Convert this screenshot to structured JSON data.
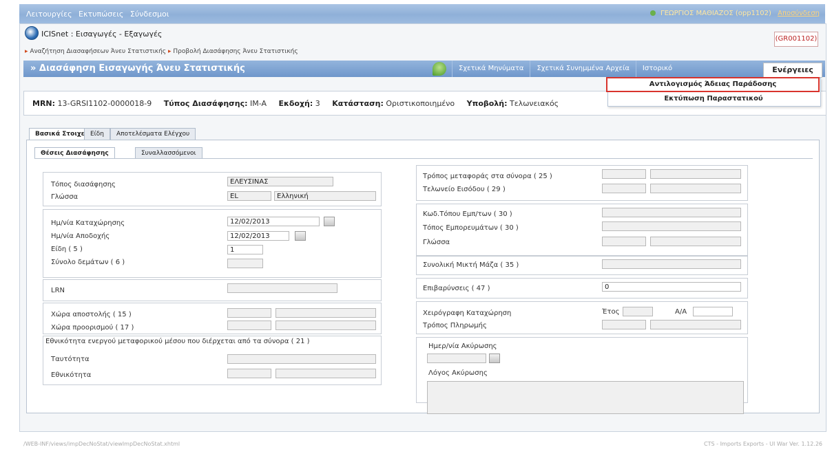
{
  "topbar": {
    "menu": [
      "Λειτουργίες",
      "Εκτυπώσεις",
      "Σύνδεσμοι"
    ],
    "user": "ΓΕΩΡΓΙΟΣ ΜΑΘΙΑΖΟΣ (opp1102)",
    "logout": "Αποσύνδεση"
  },
  "app": {
    "title": "ICISnet : Εισαγωγές - Εξαγωγές",
    "office_code": "(GR001102)"
  },
  "breadcrumb": [
    "Αναζήτηση Διασαφήσεων Άνευ Στατιστικής",
    "Προβολή Διασάφησης Άνευ Στατιστικής"
  ],
  "page": {
    "title": "» Διασάφηση Εισαγωγής Άνευ Στατιστικής",
    "tabs": [
      "Σχετικά Μηνύματα",
      "Σχετικά Συνημμένα Αρχεία",
      "Ιστορικό"
    ],
    "actions": "Ενέργειες",
    "dropdown": [
      "Αντιλογισμός Άδειας Παράδοσης",
      "Εκτύπωση Παραστατικού"
    ]
  },
  "info": {
    "mrn_label": "MRN:",
    "mrn": "13-GRSI1102-0000018-9",
    "type_label": "Τύπος Διασάφησης:",
    "type": "IM-A",
    "version_label": "Εκδοχή:",
    "version": "3",
    "status_label": "Κατάσταση:",
    "status": "Οριστικοποιημένο",
    "submission_label": "Υποβολή:",
    "submission": "Τελωνειακός"
  },
  "main_tabs": [
    "Βασικά Στοιχεία",
    "Είδη",
    "Αποτελέσματα Ελέγχου"
  ],
  "sub_tabs": [
    "Θέσεις Διασάφησης",
    "Συναλλασσόμενοι"
  ],
  "left": {
    "place_label": "Τόπος διασάφησης",
    "place_value": "ΕΛΕΥΣΙΝΑΣ",
    "lang_label": "Γλώσσα",
    "lang_code": "EL",
    "lang_name": "Ελληνική",
    "reg_date_label": "Ημ/νία Καταχώρησης",
    "reg_date": "12/02/2013",
    "acc_date_label": "Ημ/νία Αποδοχής",
    "acc_date": "12/02/2013",
    "items_label": "Είδη ( 5 )",
    "items_value": "1",
    "packages_label": "Σύνολο δεμάτων ( 6 )",
    "lrn_label": "LRN",
    "dispatch_label": "Χώρα αποστολής ( 15 )",
    "dest_label": "Χώρα προορισμού ( 17 )",
    "nationality_header": "Εθνικότητα ενεργού μεταφορικού μέσου που διέρχεται από τα σύνορα ( 21 )",
    "identity_label": "Ταυτότητα",
    "nationality_label": "Εθνικότητα"
  },
  "right": {
    "transport_label": "Τρόπος μεταφοράς στα σύνορα ( 25 )",
    "entry_office_label": "Τελωνείο Εισόδου ( 29 )",
    "goods_loc_code_label": "Κωδ.Τόπου Εμπ/των ( 30 )",
    "goods_loc_label": "Τόπος Εμπορευμάτων ( 30 )",
    "lang_label": "Γλώσσα",
    "gross_mass_label": "Συνολική Μικτή Μάζα ( 35 )",
    "charges_label": "Επιβαρύνσεις ( 47 )",
    "charges_value": "0",
    "manual_reg_label": "Χειρόγραφη Καταχώρηση",
    "year_label": "Έτος",
    "aa_label": "Α/Α",
    "payment_label": "Τρόπος Πληρωμής",
    "cancel_date_label": "Ημερ/νία Ακύρωσης",
    "cancel_reason_label": "Λόγος Ακύρωσης"
  },
  "status": {
    "left": "/WEB-INF/views/impDecNoStat/viewImpDecNoStat.xhtml",
    "right": "CTS - Imports Exports - UI War Ver. 1.12.26"
  }
}
